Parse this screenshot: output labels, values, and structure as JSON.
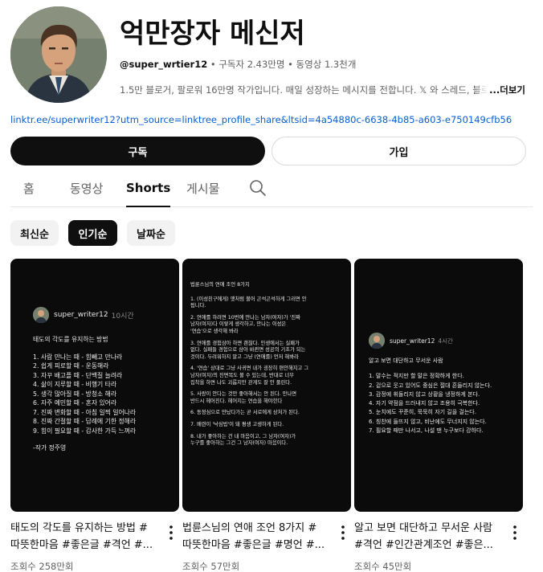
{
  "channel": {
    "name": "억만장자 메신저",
    "handle": "@super_wrtier12",
    "meta_rest": " • 구독자 2.43만명 • 동영상 1.3천개",
    "description": "1.5만 블로거, 팔로워 16만명 작가입니다. 매일 성장하는 메시지를 전합니다. 𝕏 와 스레드, 블로그에서 만나요",
    "more_label": "...더보기",
    "link": "linktr.ee/superwriter12?utm_source=linktree_profile_share&ltsid=4a54880c-6638-4b85-a603-e750149cfb56"
  },
  "buttons": {
    "subscribe": "구독",
    "join": "가입"
  },
  "tabs": [
    "홈",
    "동영상",
    "Shorts",
    "게시물"
  ],
  "active_tab": "Shorts",
  "chips": [
    "최신순",
    "인기순",
    "날짜순"
  ],
  "active_chip": "인기순",
  "shorts": [
    {
      "author": "super_writer12",
      "time": "10시간",
      "heading": "태도의 각도를 유지하는 방법",
      "lines": [
        "1. 사람 만나는 때 - 힘빼고 만나라",
        "2. 쉽게 피로할 때 - 운동해라",
        "3. 자꾸 배고플 때 - 단백질 늘려라",
        "4. 삶이 지루할 때 - 비행기 타라",
        "5. 생각 많아질 때 - 방청소 해라",
        "6. 자주 예민할 때 - 혼자 있어라",
        "7. 진짜 변화할 때 - 아침 일찍 일어나라",
        "8. 진짜 간절할 때 - 답례에 기한 정해라",
        "9. 힘이 필요할 때 - 감사한 가득 느껴라"
      ],
      "signature": "-작가 정주영",
      "title_line1": "태도의 각도를 유지하는 방법 #",
      "title_line2": "따뜻한마음 #좋은글 #격언 #...",
      "views": "조회수 258만회"
    },
    {
      "heading": "법륜스님의 연애 조언 8가지",
      "lines": [
        "1. (이성친구에게) 옛처럼 볼어 곤석곤석하게 그러면 안",
        "됩니다.",
        "2. 연애를 하려면 10번에 만나는 남자(여자)가 '진짜",
        "남자(여자)다 이렇게 생각하고, 만나는 이성은",
        "'연습'으로 생각해 봐라",
        "3. 연애를 경험삼아 하면 괜찮다. 인생에서는 실패가",
        "없다. 실패들 경험으로 삼아 바뀐면 성공의 기초가 되는",
        "것이다. 두려워하지 말고 그냥 (연애를) 먼저 해봐라",
        "4. '연습' 상대로 그냥 사귀면 내가 굉장히 편안해지고 그",
        "남자(여자)의 진면목도 볼 수 있는데, 반대로 너무",
        "집착을 하면 나도 괴롭지만 관계도 잘 안 풀린다.",
        "5. 사랑이 안다는 것만 좋아해서는 안 된다. 만나면",
        "반드시 헤어진다. 헤어지는 연습을 해야한다",
        "6. 동정심으로 만났다가는 곧 서로에게 상처가 된다.",
        "7. 배련이 '낙심밥'이 돼 평생 고생하게 된다.",
        "8. 내가 좋아하는 건 내 마음이고, 그 남자(여자)가",
        "누구를 좋아하는 그건 그 남자(여자) 마음이다."
      ],
      "title_line1": "법륜스님의 연애 조언 8가지 #",
      "title_line2": "따뜻한마음 #좋은글 #명언 #...",
      "views": "조회수 57만회"
    },
    {
      "author": "super_writer12",
      "time": "4시간",
      "heading": "알고 보면 대단하고 무서운 사람",
      "lines": [
        "1. 말수는 적지만 할 말은 정확하게 한다.",
        "2. 겉으로 웃고 있어도 중심은 절대 흔들리지 않는다.",
        "3. 감정에 휘둘리지 않고 상황을 냉정하게 본다.",
        "4. 자기 약점을 드러내지 않고 조용히 극복한다.",
        "5. 눈치에도 꾸준히, 묵묵히 자기 길을 걸는다.",
        "6. 칭찬에 들뜨지 않고, 비난에도 무너지지 않는다.",
        "7. 필요할 때만 나서고, 나설 땐 누구보다 강하다."
      ],
      "title_line1": "알고 보면 대단하고 무서운 사람",
      "title_line2": "#격언 #인간관계조언 #좋은...",
      "views": "조회수 45만회"
    }
  ]
}
